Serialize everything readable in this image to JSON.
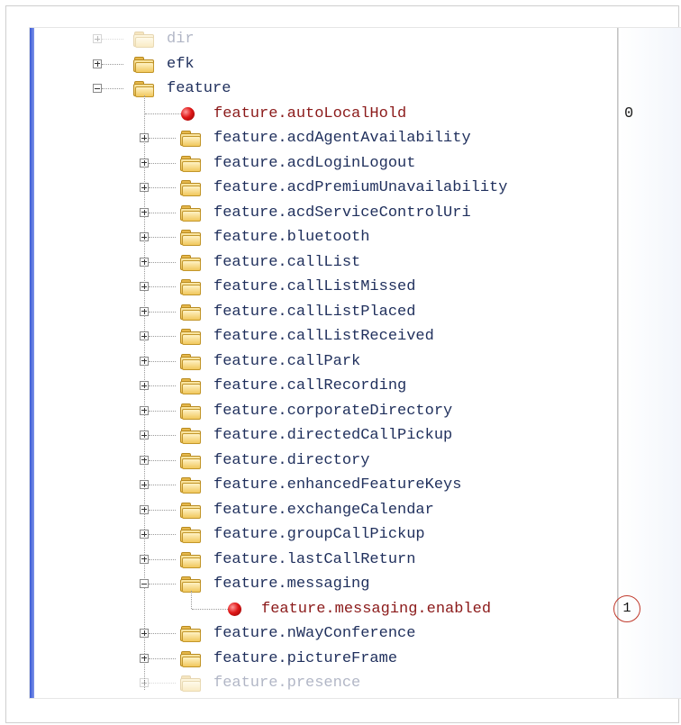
{
  "tree": {
    "top_nodes": [
      {
        "label": "dir",
        "state": "collapsed",
        "faded": true
      },
      {
        "label": "efk",
        "state": "collapsed",
        "faded": false
      },
      {
        "label": "feature",
        "state": "expanded",
        "faded": false
      }
    ],
    "feature_children": [
      {
        "label": "feature.autoLocalHold",
        "kind": "leaf",
        "value": "0"
      },
      {
        "label": "feature.acdAgentAvailability",
        "kind": "folder",
        "state": "collapsed"
      },
      {
        "label": "feature.acdLoginLogout",
        "kind": "folder",
        "state": "collapsed"
      },
      {
        "label": "feature.acdPremiumUnavailability",
        "kind": "folder",
        "state": "collapsed"
      },
      {
        "label": "feature.acdServiceControlUri",
        "kind": "folder",
        "state": "collapsed"
      },
      {
        "label": "feature.bluetooth",
        "kind": "folder",
        "state": "collapsed"
      },
      {
        "label": "feature.callList",
        "kind": "folder",
        "state": "collapsed"
      },
      {
        "label": "feature.callListMissed",
        "kind": "folder",
        "state": "collapsed"
      },
      {
        "label": "feature.callListPlaced",
        "kind": "folder",
        "state": "collapsed"
      },
      {
        "label": "feature.callListReceived",
        "kind": "folder",
        "state": "collapsed"
      },
      {
        "label": "feature.callPark",
        "kind": "folder",
        "state": "collapsed"
      },
      {
        "label": "feature.callRecording",
        "kind": "folder",
        "state": "collapsed"
      },
      {
        "label": "feature.corporateDirectory",
        "kind": "folder",
        "state": "collapsed"
      },
      {
        "label": "feature.directedCallPickup",
        "kind": "folder",
        "state": "collapsed"
      },
      {
        "label": "feature.directory",
        "kind": "folder",
        "state": "collapsed"
      },
      {
        "label": "feature.enhancedFeatureKeys",
        "kind": "folder",
        "state": "collapsed"
      },
      {
        "label": "feature.exchangeCalendar",
        "kind": "folder",
        "state": "collapsed"
      },
      {
        "label": "feature.groupCallPickup",
        "kind": "folder",
        "state": "collapsed"
      },
      {
        "label": "feature.lastCallReturn",
        "kind": "folder",
        "state": "collapsed"
      },
      {
        "label": "feature.messaging",
        "kind": "folder",
        "state": "expanded"
      },
      {
        "label": "feature.messaging.enabled",
        "kind": "leaf",
        "value": "1",
        "highlighted": true
      },
      {
        "label": "feature.nWayConference",
        "kind": "folder",
        "state": "collapsed"
      },
      {
        "label": "feature.pictureFrame",
        "kind": "folder",
        "state": "collapsed"
      },
      {
        "label": "feature.presence",
        "kind": "folder",
        "state": "collapsed",
        "faded": true
      }
    ]
  },
  "colors": {
    "folder_label": "#1f2f5c",
    "leaf_label": "#8b1a1a",
    "leaf_bullet": "#e01818",
    "highlight_circle": "#c0392b",
    "left_accent": "#3a5bd6"
  }
}
